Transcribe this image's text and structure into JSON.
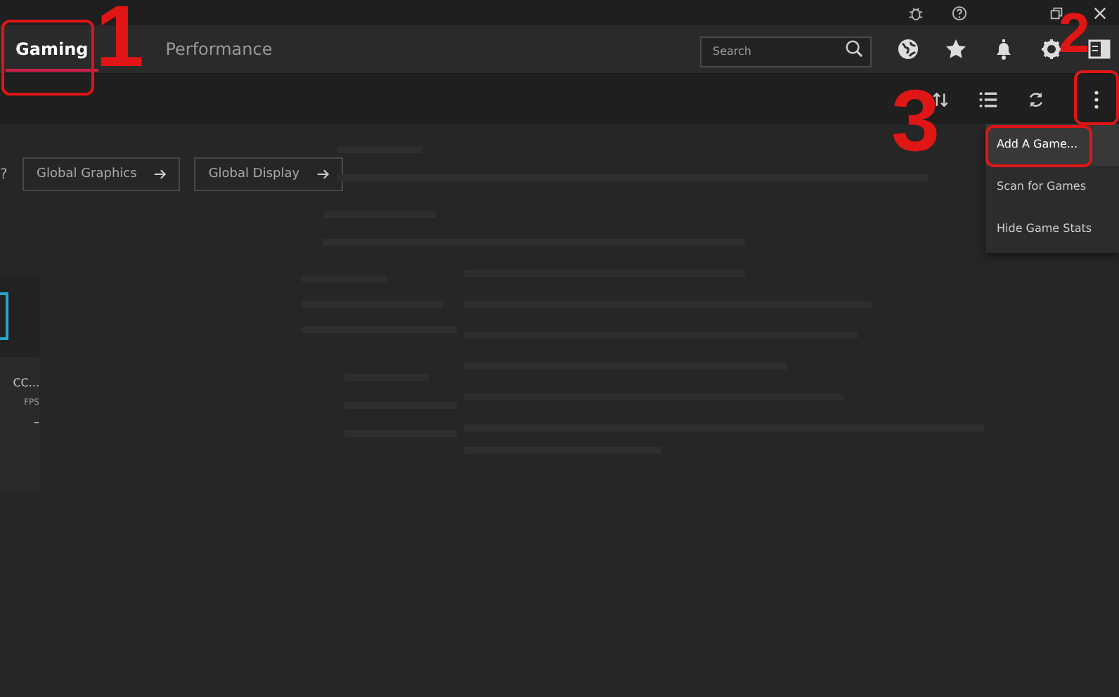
{
  "tabs": [
    {
      "label": "Gaming",
      "selected": true
    },
    {
      "label": "Performance",
      "selected": false
    }
  ],
  "search": {
    "placeholder": "Search"
  },
  "content": {
    "prompt": "?",
    "buttons": [
      "Global Graphics",
      "Global Display"
    ]
  },
  "game_card": {
    "title": "CC...",
    "stat": "FPS",
    "value": "–"
  },
  "menu": [
    {
      "label": "Add A Game...",
      "selected": true
    },
    {
      "label": "Scan for Games",
      "selected": false
    },
    {
      "label": "Hide Game Stats",
      "selected": false
    }
  ],
  "annotations": [
    {
      "label": "1"
    },
    {
      "label": "2"
    },
    {
      "label": "3"
    }
  ]
}
